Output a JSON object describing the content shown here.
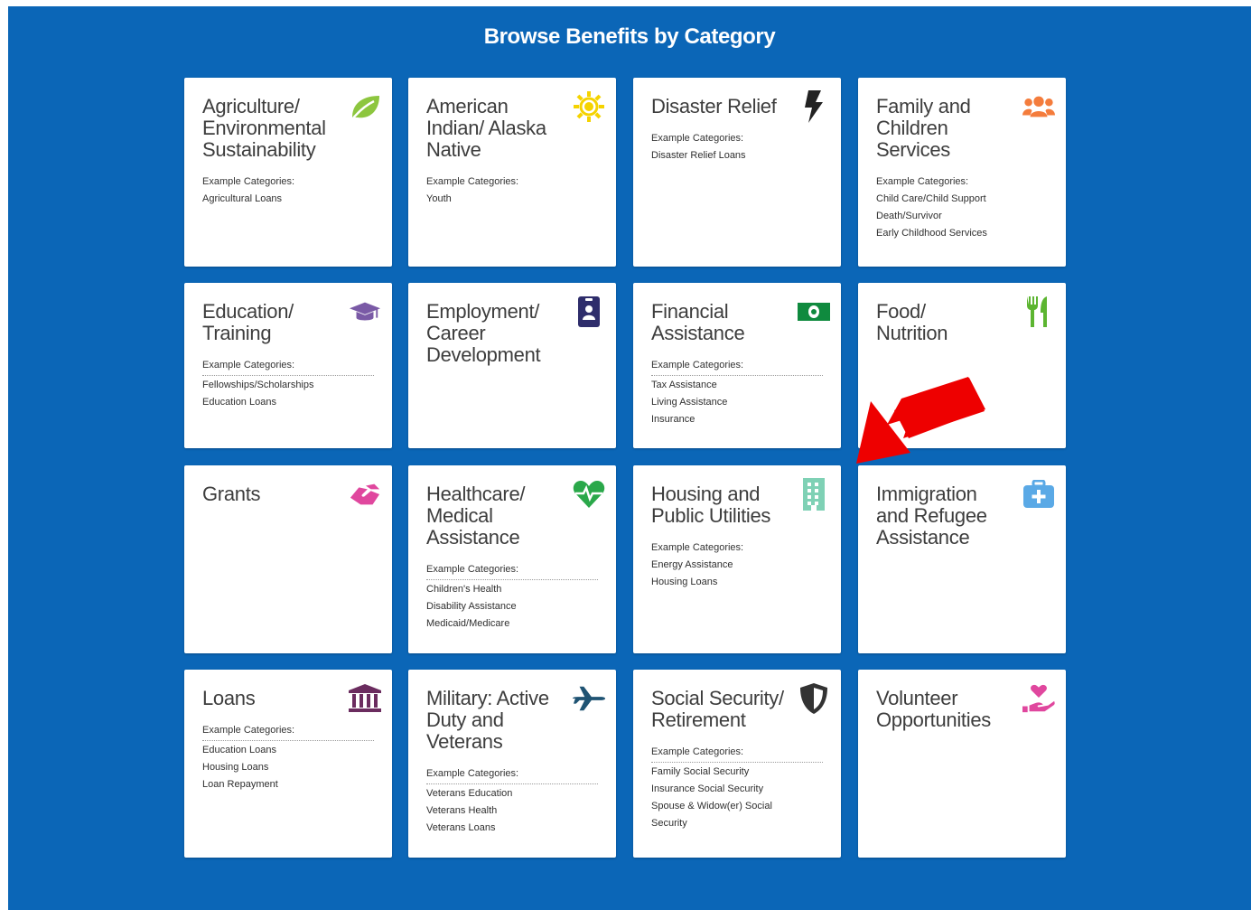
{
  "header": {
    "title": "Browse Benefits by Category"
  },
  "example_heading": "Example Categories:",
  "colors": {
    "background": "#0b66b7",
    "card": "#ffffff",
    "arrow": "#ee0000"
  },
  "cards": [
    {
      "title": [
        "Agriculture/",
        "Environmental",
        "Sustainability"
      ],
      "icon": "leaf-icon",
      "icon_color": "#8dc63f",
      "examples": [
        "Agricultural Loans"
      ]
    },
    {
      "title": [
        "American",
        "Indian/ Alaska",
        "Native"
      ],
      "icon": "sun-icon",
      "icon_color": "#f5d300",
      "examples": [
        "Youth"
      ]
    },
    {
      "title": [
        "Disaster Relief"
      ],
      "icon": "lightning-icon",
      "icon_color": "#222222",
      "examples": [
        "Disaster Relief Loans"
      ]
    },
    {
      "title": [
        "Family and",
        "Children",
        "Services"
      ],
      "icon": "people-group-icon",
      "icon_color": "#f47c3c",
      "examples": [
        "Child Care/Child Support",
        "Death/Survivor",
        "Early Childhood Services"
      ]
    },
    {
      "title": [
        "Education/",
        "Training"
      ],
      "icon": "graduation-cap-icon",
      "icon_color": "#7a5aa6",
      "examples": [
        "Fellowships/Scholarships",
        "Education Loans"
      ]
    },
    {
      "title": [
        "Employment/",
        "Career",
        "Development"
      ],
      "icon": "id-badge-icon",
      "icon_color": "#2e2d6b",
      "examples": []
    },
    {
      "title": [
        "Financial",
        "Assistance"
      ],
      "icon": "money-bill-icon",
      "icon_color": "#0f8a3e",
      "examples": [
        "Tax Assistance",
        "Living Assistance",
        "Insurance"
      ]
    },
    {
      "title": [
        "Food/",
        "Nutrition"
      ],
      "icon": "utensils-icon",
      "icon_color": "#5cb531",
      "examples": []
    },
    {
      "title": [
        "Grants"
      ],
      "icon": "handshake-icon",
      "icon_color": "#e0479e",
      "examples": []
    },
    {
      "title": [
        "Healthcare/",
        "Medical",
        "Assistance"
      ],
      "icon": "heartbeat-icon",
      "icon_color": "#2aa84a",
      "examples": [
        "Children's Health",
        "Disability Assistance",
        "Medicaid/Medicare"
      ]
    },
    {
      "title": [
        "Housing and",
        "Public Utilities"
      ],
      "icon": "building-icon",
      "icon_color": "#7fd1b5",
      "examples": [
        "Energy Assistance",
        "Housing Loans"
      ]
    },
    {
      "title": [
        "Immigration",
        "and Refugee",
        "Assistance"
      ],
      "icon": "medical-kit-icon",
      "icon_color": "#5aa9e6",
      "examples": []
    },
    {
      "title": [
        "Loans"
      ],
      "icon": "bank-icon",
      "icon_color": "#6b2c5f",
      "examples": [
        "Education Loans",
        "Housing Loans",
        "Loan Repayment"
      ]
    },
    {
      "title": [
        "Military: Active",
        "Duty and",
        "Veterans"
      ],
      "icon": "airplane-icon",
      "icon_color": "#1f5373",
      "examples": [
        "Veterans Education",
        "Veterans Health",
        "Veterans Loans"
      ]
    },
    {
      "title": [
        "Social Security/",
        "Retirement"
      ],
      "icon": "shield-icon",
      "icon_color": "#333333",
      "examples": [
        "Family Social Security",
        "Insurance Social Security",
        "Spouse & Widow(er) Social",
        "Security"
      ]
    },
    {
      "title": [
        "Volunteer",
        "Opportunities"
      ],
      "icon": "hand-heart-icon",
      "icon_color": "#e0479e",
      "examples": []
    }
  ]
}
